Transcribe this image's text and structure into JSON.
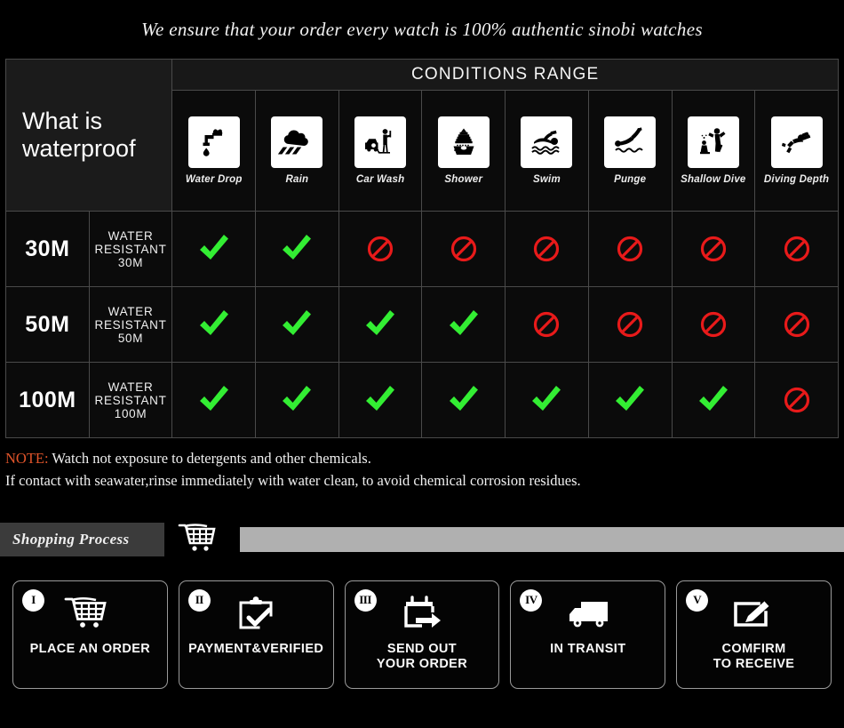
{
  "tagline": "We ensure that your order every watch is 100% authentic sinobi watches",
  "table": {
    "title": "What is waterproof",
    "range_header": "CONDITIONS RANGE",
    "conditions": [
      {
        "label": "Water Drop",
        "icon": "faucet-drop-icon"
      },
      {
        "label": "Rain",
        "icon": "rain-cloud-icon"
      },
      {
        "label": "Car Wash",
        "icon": "car-wash-icon"
      },
      {
        "label": "Shower",
        "icon": "shower-bath-icon"
      },
      {
        "label": "Swim",
        "icon": "swimmer-icon"
      },
      {
        "label": "Punge",
        "icon": "plunge-dive-icon"
      },
      {
        "label": "Shallow\nDive",
        "icon": "shallow-dive-icon"
      },
      {
        "label": "Diving\nDepth",
        "icon": "scuba-diver-icon"
      }
    ],
    "rows": [
      {
        "depth": "30M",
        "description": "WATER RESISTANT  30M",
        "marks": [
          "yes",
          "yes",
          "no",
          "no",
          "no",
          "no",
          "no",
          "no"
        ]
      },
      {
        "depth": "50M",
        "description": "WATER RESISTANT 50M",
        "marks": [
          "yes",
          "yes",
          "yes",
          "yes",
          "no",
          "no",
          "no",
          "no"
        ]
      },
      {
        "depth": "100M",
        "description": "WATER RESISTANT  100M",
        "marks": [
          "yes",
          "yes",
          "yes",
          "yes",
          "yes",
          "yes",
          "yes",
          "no"
        ]
      }
    ]
  },
  "note": {
    "keyword": "NOTE:",
    "line1": " Watch not exposure to detergents and other chemicals.",
    "line2": "If contact with seawater,rinse immediately with water clean, to avoid chemical corrosion residues."
  },
  "shopping_process": {
    "title": "Shopping Process",
    "cart_icon": "shopping-cart-icon"
  },
  "steps": [
    {
      "numeral": "I",
      "label": "PLACE AN ORDER",
      "icon": "shopping-cart-icon"
    },
    {
      "numeral": "II",
      "label": "PAYMENT&VERIFIED",
      "icon": "clipboard-check-icon"
    },
    {
      "numeral": "III",
      "label": "SEND OUT\nYOUR ORDER",
      "icon": "package-arrow-icon"
    },
    {
      "numeral": "IV",
      "label": "IN TRANSIT",
      "icon": "delivery-truck-icon"
    },
    {
      "numeral": "V",
      "label": "COMFIRM\nTO RECEIVE",
      "icon": "edit-pencil-icon"
    }
  ],
  "colors": {
    "check_green": "#33ee33",
    "deny_red": "#e81a1a",
    "note_keyword": "#e0542a",
    "rule_gray": "#b0b0b0"
  }
}
